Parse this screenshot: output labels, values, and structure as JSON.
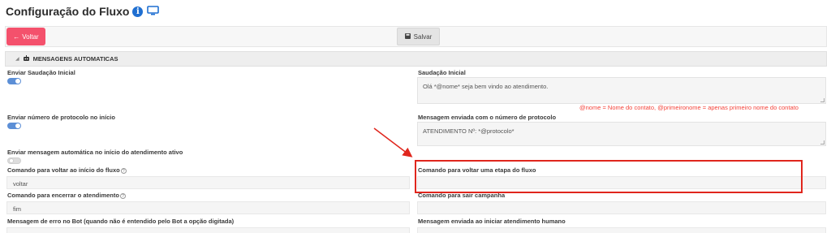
{
  "page": {
    "title": "Configuração do Fluxo",
    "info_icon": "info-icon",
    "monitor_icon": "monitor-icon"
  },
  "toolbar": {
    "back_label": "Voltar",
    "save_label": "Salvar"
  },
  "section": {
    "title": "MENSAGENS AUTOMATICAS"
  },
  "left": {
    "greeting_toggle_label": "Enviar Saudação Inicial",
    "greeting_toggle_on": true,
    "protocol_toggle_label": "Enviar número de protocolo no início",
    "protocol_toggle_on": true,
    "active_start_label": "Enviar mensagem automática no início do atendimento ativo",
    "active_start_on": false,
    "back_to_start_label": "Comando para voltar ao início do fluxo",
    "back_to_start_value": "voltar",
    "end_label": "Comando para encerrar o atendimento",
    "end_value": "fim",
    "bot_error_label": "Mensagem de erro no Bot (quando não é entendido pelo Bot a opção digitada)"
  },
  "right": {
    "greeting_label": "Saudação Inicial",
    "greeting_value": "Olá *@nome* seja bem vindo ao atendimento.",
    "greeting_hint": "@nome = Nome do contato, @primeironome = apenas primeiro nome do contato",
    "protocol_label": "Mensagem enviada com o número de protocolo",
    "protocol_value": "ATENDIMENTO Nº: *@protocolo*",
    "back_step_label": "Comando para voltar uma etapa do fluxo",
    "back_step_value": "",
    "leave_campaign_label": "Comando para sair campanha",
    "human_start_label": "Mensagem enviada ao iniciar atendimento humano"
  },
  "colors": {
    "danger": "#f4516c",
    "accent": "#5c8fd6",
    "annotation": "#e0261d",
    "hint": "#f4433a"
  }
}
